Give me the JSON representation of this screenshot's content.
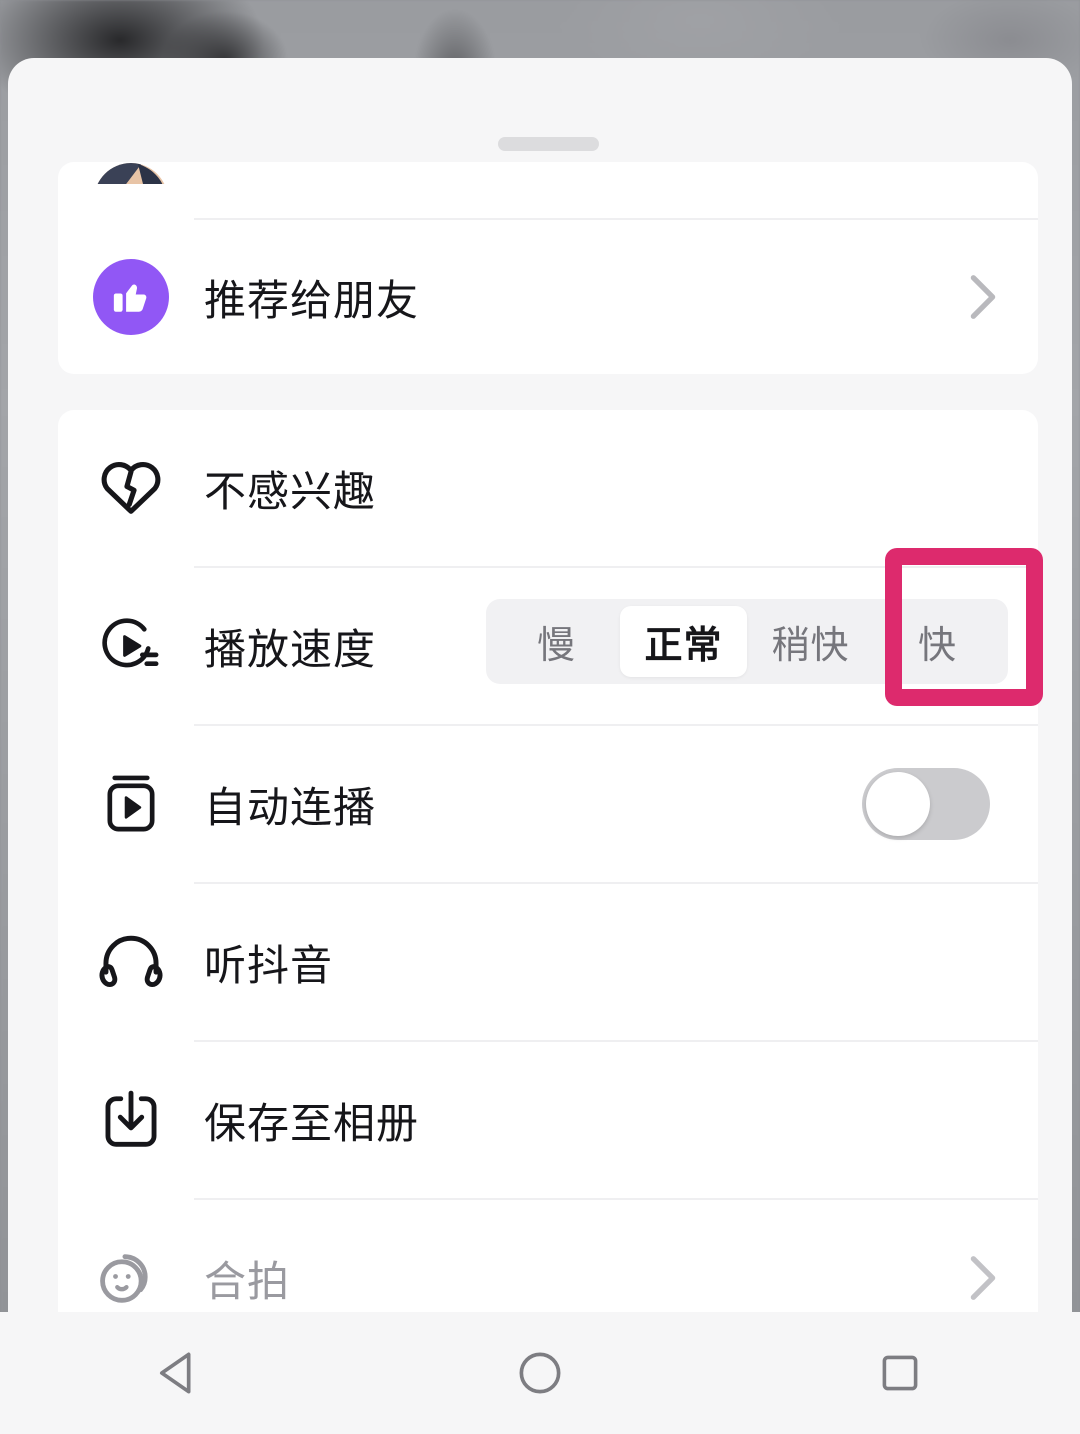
{
  "background": {
    "description": "blurred-grayscale-video"
  },
  "sheet": {
    "handle_name": "drag-handle"
  },
  "share_card": {
    "items": [
      {
        "icon": "thumbs-up-icon",
        "label": "推荐给朋友",
        "accent": "#9157f5",
        "chevron": "chevron-right-icon"
      }
    ]
  },
  "tools_card": {
    "items": [
      {
        "icon": "broken-heart-icon",
        "label": "不感兴趣",
        "disabled": false
      },
      {
        "icon": "play-speed-icon",
        "label": "播放速度",
        "disabled": false
      },
      {
        "icon": "autoplay-icon",
        "label": "自动连播",
        "disabled": false
      },
      {
        "icon": "headphones-icon",
        "label": "听抖音",
        "disabled": false
      },
      {
        "icon": "download-icon",
        "label": "保存至相册",
        "disabled": false
      },
      {
        "icon": "duet-face-icon",
        "label": "合拍",
        "disabled": true
      }
    ]
  },
  "speed_control": {
    "options": [
      {
        "label": "慢",
        "selected": false
      },
      {
        "label": "正常",
        "selected": true
      },
      {
        "label": "稍快",
        "selected": false
      },
      {
        "label": "快",
        "selected": false
      }
    ],
    "selected_value": "正常"
  },
  "autoplay_switch": {
    "state": "off"
  },
  "highlight": {
    "target": "快",
    "color": "#dd2a6d"
  },
  "nav_bar": {
    "buttons": [
      {
        "name": "back-button",
        "icon": "triangle-left-icon"
      },
      {
        "name": "home-button",
        "icon": "circle-icon"
      },
      {
        "name": "recents-button",
        "icon": "square-icon"
      }
    ],
    "color": "#7d7d82"
  }
}
